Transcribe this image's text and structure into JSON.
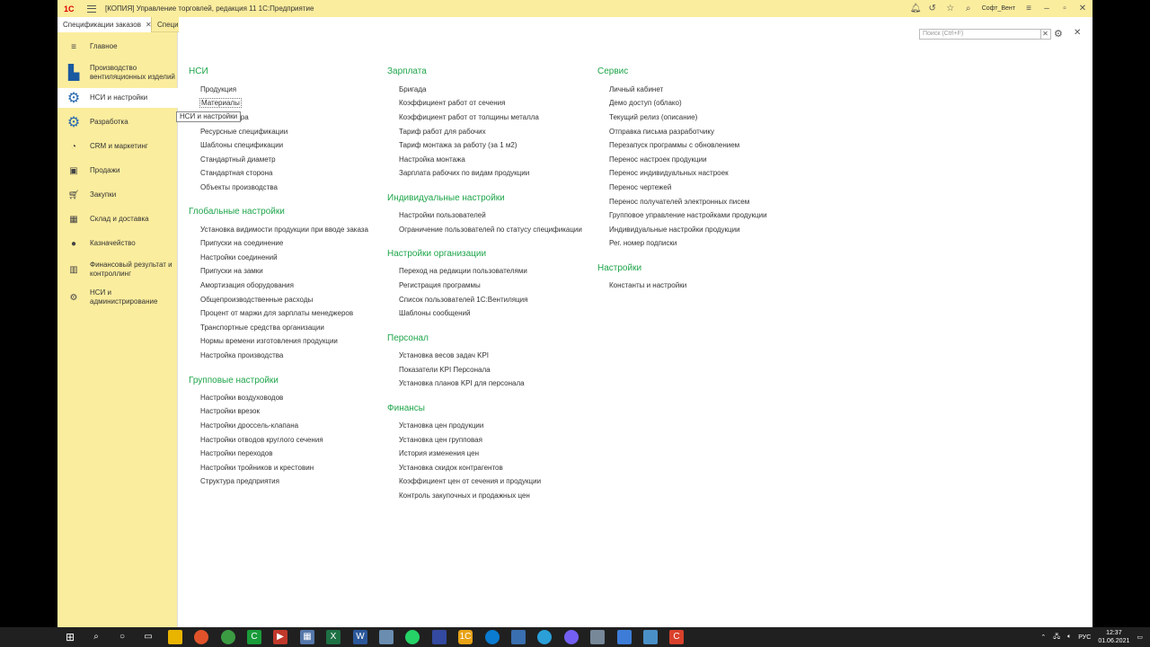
{
  "window": {
    "title": "[КОПИЯ] Управление торговлей, редакция 11 1С:Предприятие",
    "logo_text": "1С",
    "user": "Софт_Вент"
  },
  "tabs": [
    {
      "label": "Спецификации заказов"
    },
    {
      "label": "Специф"
    }
  ],
  "sidebar": {
    "items": [
      {
        "label": "Главное",
        "icon": "menu-icon"
      },
      {
        "label": "Производство вентиляционных изделий",
        "icon": "production-icon"
      },
      {
        "label": "НСИ и настройки",
        "icon": "settings-gears-icon"
      },
      {
        "label": "Разработка",
        "icon": "development-icon"
      },
      {
        "label": "CRM и маркетинг",
        "icon": "crm-icon"
      },
      {
        "label": "Продажи",
        "icon": "sales-icon"
      },
      {
        "label": "Закупки",
        "icon": "purchase-icon"
      },
      {
        "label": "Склад и доставка",
        "icon": "warehouse-icon"
      },
      {
        "label": "Казначейство",
        "icon": "treasury-icon"
      },
      {
        "label": "Финансовый результат и контроллинг",
        "icon": "finance-icon"
      },
      {
        "label": "НСИ и администрирование",
        "icon": "admin-gear-icon"
      }
    ],
    "tooltip": "НСИ и настройки"
  },
  "search": {
    "placeholder": "Поиск (Ctrl+F)"
  },
  "sections": {
    "nsi": {
      "title": "НСИ",
      "items": [
        "Продукция",
        "Материалы",
        "Номенклатура",
        "Ресурсные спецификации",
        "Шаблоны спецификации",
        "Стандартный диаметр",
        "Стандартная сторона",
        "Объекты производства"
      ]
    },
    "global": {
      "title": "Глобальные настройки",
      "items": [
        "Установка видимости продукции при вводе заказа",
        "Припуски на соединение",
        "Настройки соединений",
        "Припуски на замки",
        "Амортизация оборудования",
        "Общепроизводственные расходы",
        "Процент от маржи для зарплаты менеджеров",
        "Транспортные средства организации",
        "Нормы времени изготовления продукции",
        "Настройка производства"
      ]
    },
    "group": {
      "title": "Групповые настройки",
      "items": [
        "Настройки воздуховодов",
        "Настройки врезок",
        "Настройки дроссель-клапана",
        "Настройки отводов круглого сечения",
        "Настройки переходов",
        "Настройки тройников и крестовин",
        "Структура предприятия"
      ]
    },
    "salary": {
      "title": "Зарплата",
      "items": [
        "Бригада",
        "Коэффициент работ от сечения",
        "Коэффициент работ от толщины металла",
        "Тариф работ для рабочих",
        "Тариф монтажа за работу (за 1 м2)",
        "Настройка монтажа",
        "Зарплата рабочих по видам продукции"
      ]
    },
    "individual": {
      "title": "Индивидуальные настройки",
      "items": [
        "Настройки пользователей",
        "Ограничение пользователей по статусу спецификации"
      ]
    },
    "org": {
      "title": "Настройки организации",
      "items": [
        "Переход на редакции пользователями",
        "Регистрация программы",
        "Список пользователей 1С:Вентиляция",
        "Шаблоны сообщений"
      ]
    },
    "staff": {
      "title": "Персонал",
      "items": [
        "Установка весов задач KPI",
        "Показатели KPI Персонала",
        "Установка планов KPI для персонала"
      ]
    },
    "finance": {
      "title": "Финансы",
      "items": [
        "Установка цен продукции",
        "Установка цен групповая",
        "История изменения цен",
        "Установка скидок контрагентов",
        "Коэффициент цен от сечения и продукции",
        "Контроль закупочных и продажных цен"
      ]
    },
    "service": {
      "title": "Сервис",
      "items": [
        "Личный кабинет",
        "Демо доступ (облако)",
        "Текущий релиз (описание)",
        "Отправка письма разработчику",
        "Перезапуск программы с обновлением",
        "Перенос настроек продукции",
        "Перенос индивидуальных настроек",
        "Перенос чертежей",
        "Перенос получателей электронных писем",
        "Групповое управление настройками продукции",
        "Индивидуальные настройки продукции",
        "Рег. номер подписки"
      ]
    },
    "settings": {
      "title": "Настройки",
      "items": [
        "Константы и настройки"
      ]
    }
  },
  "taskbar": {
    "lang": "РУС",
    "time": "12:37",
    "date": "01.06.2021"
  }
}
